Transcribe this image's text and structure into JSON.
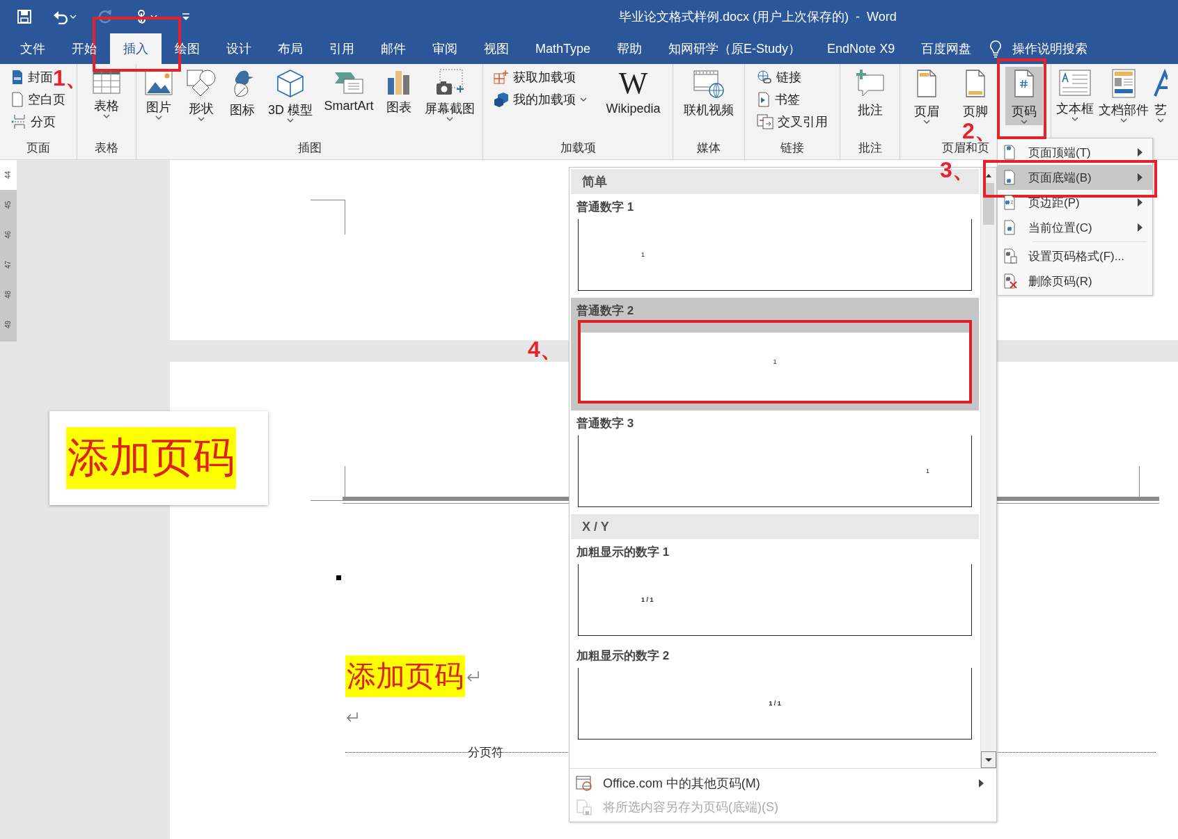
{
  "window": {
    "title": "毕业论文格式样例.docx (用户上次保存的)  -  Word"
  },
  "quick_access": [
    {
      "kind": "save",
      "disabled": false,
      "dropdown": false
    },
    {
      "kind": "undo",
      "disabled": false,
      "dropdown": true
    },
    {
      "kind": "redo",
      "disabled": true,
      "dropdown": false
    },
    {
      "kind": "touch",
      "disabled": false,
      "dropdown": true
    },
    {
      "kind": "customize",
      "disabled": false,
      "dropdown": false
    }
  ],
  "tabs": [
    {
      "label": "文件",
      "selected": false
    },
    {
      "label": "开始",
      "selected": false
    },
    {
      "label": "插入",
      "selected": true
    },
    {
      "label": "绘图",
      "selected": false
    },
    {
      "label": "设计",
      "selected": false
    },
    {
      "label": "布局",
      "selected": false
    },
    {
      "label": "引用",
      "selected": false
    },
    {
      "label": "邮件",
      "selected": false
    },
    {
      "label": "审阅",
      "selected": false
    },
    {
      "label": "视图",
      "selected": false
    },
    {
      "label": "MathType",
      "selected": false
    },
    {
      "label": "帮助",
      "selected": false
    },
    {
      "label": "知网研学（原E-Study）",
      "selected": false
    },
    {
      "label": "EndNote X9",
      "selected": false
    },
    {
      "label": "百度网盘",
      "selected": false
    }
  ],
  "tell_me": {
    "placeholder": "操作说明搜索"
  },
  "ribbon": [
    {
      "label": "页面",
      "items": [
        {
          "kind": "small",
          "label": "封面",
          "dropdown": false,
          "pressed": false
        },
        {
          "kind": "small",
          "label": "空白页",
          "dropdown": false,
          "pressed": false
        },
        {
          "kind": "small",
          "label": "分页",
          "dropdown": false,
          "pressed": false
        }
      ]
    },
    {
      "label": "表格",
      "items": [
        {
          "kind": "large",
          "label": "表格",
          "dropdown": true,
          "pressed": false
        }
      ]
    },
    {
      "label": "插图",
      "items": [
        {
          "kind": "large",
          "label": "图片",
          "dropdown": true,
          "pressed": false
        },
        {
          "kind": "large",
          "label": "形状",
          "dropdown": true,
          "pressed": false
        },
        {
          "kind": "large",
          "label": "图标",
          "dropdown": false,
          "pressed": false
        },
        {
          "kind": "large",
          "label": "3D 模型",
          "dropdown": true,
          "pressed": false
        },
        {
          "kind": "large",
          "label": "SmartArt",
          "dropdown": false,
          "pressed": false
        },
        {
          "kind": "large",
          "label": "图表",
          "dropdown": false,
          "pressed": false
        },
        {
          "kind": "large",
          "label": "屏幕截图",
          "dropdown": true,
          "pressed": false
        }
      ]
    },
    {
      "label": "加载项",
      "items": [
        {
          "kind": "small",
          "label": "获取加载项",
          "dropdown": false,
          "pressed": false
        },
        {
          "kind": "small",
          "label": "我的加载项",
          "dropdown": true,
          "pressed": false
        },
        {
          "kind": "large",
          "label": "Wikipedia",
          "icon_text": "W",
          "dropdown": false,
          "pressed": false
        }
      ]
    },
    {
      "label": "媒体",
      "items": [
        {
          "kind": "large",
          "label": "联机视频",
          "dropdown": false,
          "pressed": false
        }
      ]
    },
    {
      "label": "链接",
      "items": [
        {
          "kind": "small",
          "label": "链接",
          "dropdown": false,
          "pressed": false
        },
        {
          "kind": "small",
          "label": "书签",
          "dropdown": false,
          "pressed": false
        },
        {
          "kind": "small",
          "label": "交叉引用",
          "dropdown": false,
          "pressed": false
        }
      ]
    },
    {
      "label": "批注",
      "items": [
        {
          "kind": "large",
          "label": "批注",
          "dropdown": false,
          "pressed": false
        }
      ]
    },
    {
      "label": "页眉和页",
      "items": [
        {
          "kind": "large",
          "label": "页眉",
          "dropdown": true,
          "pressed": false
        },
        {
          "kind": "large",
          "label": "页脚",
          "dropdown": false,
          "pressed": false
        },
        {
          "kind": "large",
          "label": "页码",
          "dropdown": true,
          "pressed": true
        }
      ]
    },
    {
      "items": [
        {
          "kind": "large",
          "label": "文本框",
          "dropdown": true,
          "pressed": false
        },
        {
          "kind": "large",
          "label": "文档部件",
          "dropdown": true,
          "pressed": false
        },
        {
          "kind": "large",
          "label": "艺",
          "dropdown": true,
          "pressed": false
        }
      ]
    }
  ],
  "ruler": {
    "numbers": [
      "44",
      "45",
      "46",
      "47",
      "48",
      "49"
    ]
  },
  "document": {
    "callout": "添加页码",
    "body_text": "添加页码",
    "page_break": "分页符"
  },
  "gallery": {
    "sections": [
      {
        "heading": "简单",
        "items": [
          {
            "name": "普通数字 1",
            "number": "1",
            "bold": false,
            "selected": false
          },
          {
            "name": "普通数字 2",
            "number": "1",
            "bold": false,
            "selected": true
          },
          {
            "name": "普通数字 3",
            "number": "1",
            "bold": false,
            "selected": false
          }
        ]
      },
      {
        "heading": "X / Y",
        "items": [
          {
            "name": "加粗显示的数字 1",
            "number": "1 / 1",
            "bold": true,
            "selected": false
          },
          {
            "name": "加粗显示的数字 2",
            "number": "1 / 1",
            "bold": true,
            "selected": false
          }
        ]
      }
    ],
    "footer": [
      {
        "label": "Office.com 中的其他页码(M)",
        "submenu": true,
        "disabled": false
      },
      {
        "label": "将所选内容另存为页码(底端)(S)",
        "submenu": false,
        "disabled": true
      }
    ]
  },
  "submenu": [
    {
      "label": "页面顶端(T)",
      "submenu": true,
      "selected": false
    },
    {
      "label": "页面底端(B)",
      "submenu": true,
      "selected": true
    },
    {
      "label": "页边距(P)",
      "submenu": true,
      "selected": false
    },
    {
      "label": "当前位置(C)",
      "submenu": true,
      "selected": false
    },
    {
      "label": "设置页码格式(F)...",
      "submenu": false,
      "selected": false
    },
    {
      "label": "删除页码(R)",
      "submenu": false,
      "selected": false
    }
  ],
  "annotations": [
    {
      "label": "1、"
    },
    {
      "label": "2、"
    },
    {
      "label": "3、"
    },
    {
      "label": "4、"
    }
  ]
}
